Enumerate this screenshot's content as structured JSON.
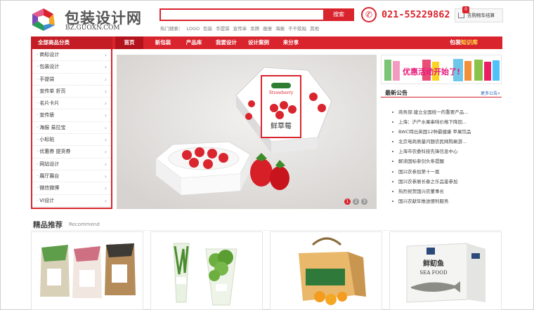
{
  "header": {
    "logo_title": "包装设计网",
    "logo_sub": "BZ.GUOXN.COM",
    "search_placeholder": "",
    "search_button": "搜索",
    "hot_label": "热门搜索：",
    "hot_keywords": [
      "LOGO",
      "包装",
      "手提袋",
      "宣传单",
      "吊牌",
      "画册",
      "海报",
      "不干胶贴",
      "其他"
    ],
    "phone": "021-55229862",
    "cart_count": "0",
    "cart_label": "去购物车结算"
  },
  "nav": {
    "category_label": "全部商品分类",
    "items": [
      "首页",
      "新包装",
      "产品库",
      "我要设计",
      "设计案例",
      "来分享"
    ],
    "right_prefix": "包装",
    "right_highlight": "知识库"
  },
  "sidebar": {
    "items": [
      "商标设计",
      "包装设计",
      "手提袋",
      "宣传单 折页",
      "名片卡片",
      "宣传册",
      "海报 易拉宝",
      "小标贴",
      "优惠券 提货券",
      "网站设计",
      "展厅展台",
      "微信微博",
      "VI设计"
    ]
  },
  "banner": {
    "box_label": "鲜草莓",
    "box_label_en": "Strawberry",
    "slides": [
      "1",
      "2",
      "3"
    ],
    "active_slide": 1
  },
  "promo": {
    "text": "优惠活动开始了!"
  },
  "news": {
    "title": "最新公告",
    "more": "更多公告»",
    "items": [
      "商务部:建立全国统一的重要产品...",
      "上海：沪产水果串味价格下降回...",
      "BWC特出英国12种最健康 苹果饮品",
      "北京电商质量问题农民网购剩游...",
      "上海市农委科技先锋信息中心",
      "解读国标参剑头条提醒",
      "国兴农参加第十一届",
      "国兴农参展长春之乐品鉴参加",
      "热烈祝贺国兴农董事长",
      "国兴农献年推送便利服务"
    ]
  },
  "recommend": {
    "title": "精品推荐",
    "subtitle": "Recommend"
  },
  "colors": {
    "accent": "#d9242e",
    "accent_dark": "#b3131c"
  }
}
